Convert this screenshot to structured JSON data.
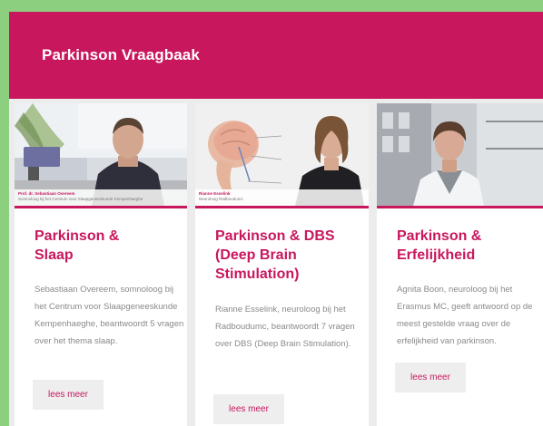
{
  "header": {
    "title": "Parkinson Vraagbaak"
  },
  "cards": [
    {
      "title": "Parkinson & Slaap",
      "description": "Sebastiaan Overeem, somnoloog bij het Centrum voor Slaapgeneeskunde Kempenhaeghe, beantwoordt 5 vragen over het thema slaap.",
      "button": "lees meer",
      "caption_name": "Prof. dr. Sebastiaan Overeem",
      "caption_role": "Somnoloog bij het Centrum voor Slaapgeneeskunde Kempenhaeghe"
    },
    {
      "title": "Parkinson & DBS (Deep Brain Stimulation)",
      "description": "Rianne Esselink, neuroloog bij het Radboudumc, beantwoordt 7 vragen over DBS (Deep Brain Stimulation).",
      "button": "lees meer",
      "caption_name": "Rianne Esselink",
      "caption_role": "Neuroloog Radboudumc"
    },
    {
      "title": "Parkinson & Erfelijkheid",
      "description": "Agnita Boon, neuroloog bij het Erasmus MC, geeft antwoord op de meest gestelde vraag over de erfelijkheid van parkinson.",
      "button": "lees meer"
    }
  ],
  "colors": {
    "accent": "#c8175d",
    "page_bg": "#8ccf7e",
    "panel_bg": "#ececec"
  }
}
